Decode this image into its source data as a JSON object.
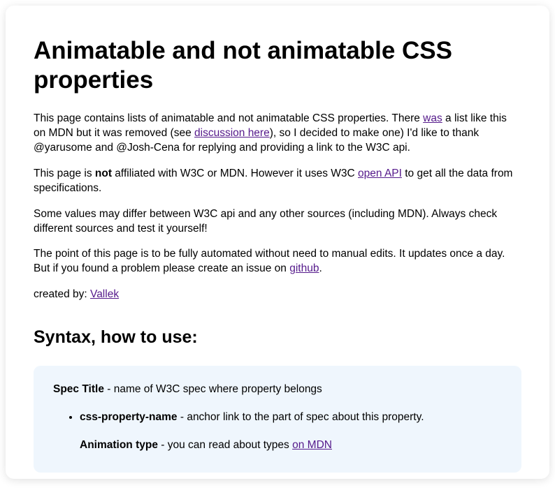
{
  "title": "Animatable and not animatable CSS properties",
  "intro": {
    "p1_a": "This page contains lists of animatable and not animatable CSS properties. There ",
    "p1_link1": "was",
    "p1_b": " a list like this on MDN but it was removed (see ",
    "p1_link2": "discussion here",
    "p1_c": "), so I decided to make one) I'd like to thank @yarusome and @Josh-Cena for replying and providing a link to the W3C api.",
    "p2_a": "This page is ",
    "p2_bold": "not",
    "p2_b": " affiliated with W3C or MDN. However it uses W3C ",
    "p2_link": "open API",
    "p2_c": " to get all the data from specifications.",
    "p3": "Some values may differ between W3C api and any other sources (including MDN). Always check different sources and test it yourself!",
    "p4_a": "The point of this page is to be fully automated without need to manual edits. It updates once a day. But if you found a problem please create an issue on ",
    "p4_link": "github",
    "p4_b": ".",
    "p5_a": "created by: ",
    "p5_link": "Vallek"
  },
  "syntax": {
    "heading": "Syntax, how to use:",
    "spec_label": "Spec Title",
    "spec_desc": " - name of W3C spec where property belongs",
    "prop_label": "css-property-name",
    "prop_desc": " - anchor link to the part of spec about this property.",
    "anim_label": "Animation type",
    "anim_desc": " - you can read about types ",
    "anim_link": "on MDN"
  }
}
